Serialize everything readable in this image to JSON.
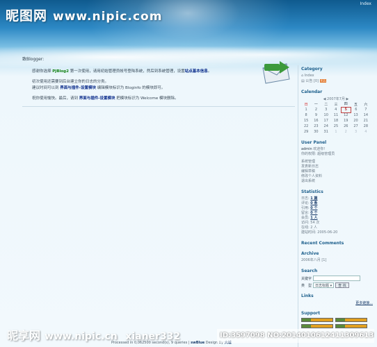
{
  "watermark": {
    "top_brand": "昵图网",
    "top_url": "www.nipic.com",
    "bottom_brand": "昵享网",
    "bottom_url": "www.nipic.cn",
    "bottom_user": "xianer332",
    "id_text": "ID:3597098 NO:20140106124113096135"
  },
  "header": {
    "topbar_link": "Index"
  },
  "main": {
    "greeting": "致Blogger:",
    "p1_pre": "感谢你选择 ",
    "p1_brand": "PJBlog2",
    "p1_mid": " 第一次使用，请用初始管理员帐号登陆系统，然后到系统管理，设置",
    "p1_link": "站点基本信息",
    "p1_end": "。",
    "p2_line1": "初次使用还需要到后台建立你的日志的分类。",
    "p2_pre": "建议时间可以到 ",
    "p2_link": "界面与插件-设置模块",
    "p2_post": " 编辑模块标识为 Bloginfo 的模块即可。",
    "p3_pre": "祝你使用愉快。最后，请到 ",
    "p3_link": "界面与插件-设置模块",
    "p3_post": " 把模块标识为 Welcome 模块删除。"
  },
  "sidebar": {
    "category": {
      "title": "Category",
      "items": [
        "Index",
        "公告 [0]"
      ]
    },
    "calendar": {
      "title": "Calendar",
      "caption": "2007年7月",
      "prev": "◀",
      "next": "▶",
      "weekdays": [
        "日",
        "一",
        "二",
        "三",
        "四",
        "五",
        "六"
      ],
      "today": "5",
      "weeks": [
        [
          "1",
          "2",
          "3",
          "4",
          "5",
          "6",
          "7"
        ],
        [
          "8",
          "9",
          "10",
          "11",
          "12",
          "13",
          "14"
        ],
        [
          "15",
          "16",
          "17",
          "18",
          "19",
          "20",
          "21"
        ],
        [
          "22",
          "23",
          "24",
          "25",
          "26",
          "27",
          "28"
        ],
        [
          "29",
          "30",
          "31",
          "1",
          "2",
          "3",
          "4"
        ]
      ]
    },
    "user_panel": {
      "title": "User Panel",
      "welcome_user": "admin",
      "welcome_text": " 欢迎你!",
      "identity": "你的权限: 超级管理员",
      "links": [
        "系统管理",
        "发表新日志",
        "编辑草稿",
        "修改个人资料",
        "退出系统"
      ]
    },
    "statistics": {
      "title": "Statistics",
      "rows": [
        {
          "label": "日志: ",
          "value": "1 篇"
        },
        {
          "label": "评论: ",
          "value": "0 条"
        },
        {
          "label": "引用: ",
          "value": "0 个"
        },
        {
          "label": "留言: ",
          "value": "0 个"
        },
        {
          "label": "会员: ",
          "value": "1 人"
        },
        {
          "label": "访问: ",
          "value": "54 次"
        },
        {
          "label": "在线: ",
          "value": "2 人"
        },
        {
          "label": "建站时间: ",
          "value": "2005-06-20"
        }
      ]
    },
    "recent_comments": {
      "title": "Recent Comments"
    },
    "archive": {
      "title": "Archive",
      "item": "2006年八月 [1]"
    },
    "search": {
      "title": "Search",
      "keyword_label": "关键字",
      "type_label": "类　型",
      "select_value": "日志标题",
      "button": "查 找"
    },
    "links": {
      "title": "Links",
      "more": "更多链接..."
    },
    "support": {
      "title": "Support"
    }
  },
  "footer": {
    "text": "Processed in 0,062500 second(s), 9 queries",
    "skin_label": "swBlue",
    "design_pre": "Design By",
    "designer": "大城"
  }
}
